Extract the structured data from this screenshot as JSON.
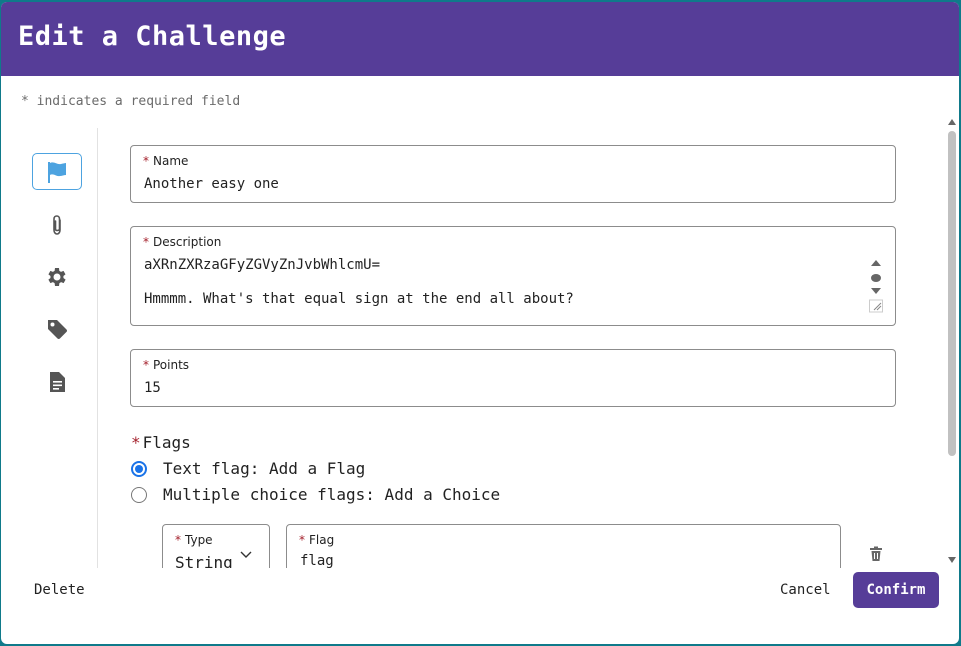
{
  "dialog": {
    "title": "Edit a Challenge",
    "required_star": "*",
    "required_note": "indicates a required field"
  },
  "nav": {
    "items": [
      {
        "icon": "flag-icon",
        "active": true
      },
      {
        "icon": "paperclip-icon",
        "active": false
      },
      {
        "icon": "gear-icon",
        "active": false
      },
      {
        "icon": "tag-icon",
        "active": false
      },
      {
        "icon": "document-icon",
        "active": false
      }
    ]
  },
  "form": {
    "name": {
      "label": "Name",
      "value": "Another easy one"
    },
    "description": {
      "label": "Description",
      "line1": "aXRnZXRzaGFyZGVyZnJvbWhlcmU=",
      "line2": "Hmmmm. What's that equal sign at the end all about?"
    },
    "points": {
      "label": "Points",
      "value": "15"
    },
    "flags": {
      "title": "Flags",
      "options": [
        {
          "label": "Text flag: Add a Flag",
          "checked": true
        },
        {
          "label": "Multiple choice flags: Add a Choice",
          "checked": false
        }
      ],
      "type": {
        "label": "Type",
        "value": "String"
      },
      "flag": {
        "label": "Flag",
        "value": "flag"
      }
    }
  },
  "footer": {
    "delete_label": "Delete",
    "cancel_label": "Cancel",
    "confirm_label": "Confirm"
  },
  "colors": {
    "header": "#563d98",
    "accent": "#1a73e8",
    "required": "#a31f2a",
    "nav_icon": "#555555",
    "active_flag": "#4da3e0"
  }
}
